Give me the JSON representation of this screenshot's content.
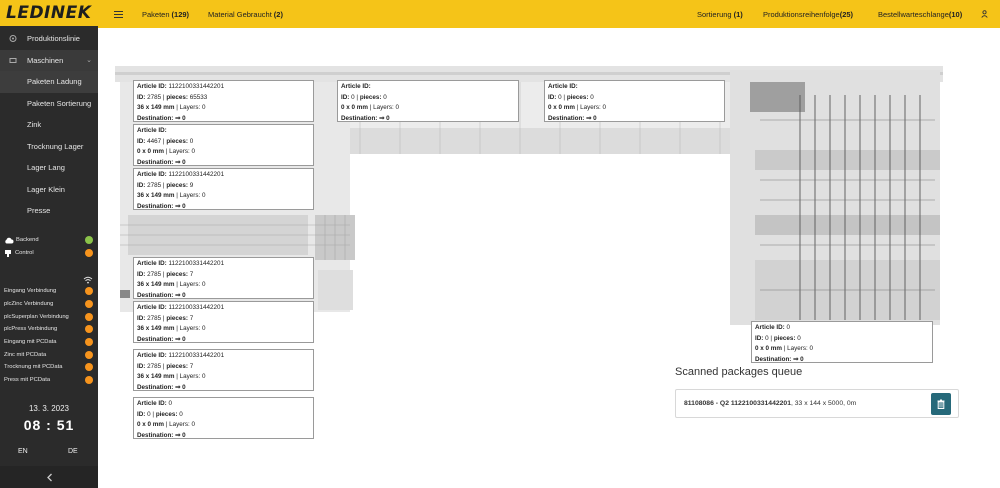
{
  "brand": {
    "logo_text": "LEDINEK"
  },
  "topbar": {
    "menu_icon": "hamburger-icon",
    "pakete_label": "Paketen",
    "pakete_count": "(129)",
    "material_label": "Material Gebraucht",
    "material_count": "(2)",
    "sortierung_label": "Sortierung",
    "sortierung_count": "(1)",
    "produktion_label": "Produktionsreihenfolge",
    "produktion_count": "(25)",
    "bestell_label": "Bestellwarteschlange",
    "bestell_count": "(10)",
    "user_icon": "user-icon"
  },
  "sidebar": {
    "items": [
      {
        "label": "Produktionslinie",
        "icon": "production-line-icon"
      },
      {
        "label": "Maschinen",
        "icon": "machine-icon"
      }
    ],
    "subitems": [
      {
        "label": "Paketen Ladung"
      },
      {
        "label": "Paketen Sortierung"
      },
      {
        "label": "Zink"
      },
      {
        "label": "Trocknung Lager"
      },
      {
        "label": "Lager Lang"
      },
      {
        "label": "Lager Klein"
      },
      {
        "label": "Presse"
      }
    ],
    "status_top": [
      {
        "label": "Backend",
        "icon": "cloud-icon",
        "state": "green"
      },
      {
        "label": "Control",
        "icon": "plug-icon",
        "state": "orange"
      }
    ],
    "connections": [
      {
        "label": "Eingang Verbindung"
      },
      {
        "label": "plcZinc Verbindung"
      },
      {
        "label": "plcSuperplan Verbindung"
      },
      {
        "label": "plcPress Verbindung"
      },
      {
        "label": "Eingang mit PCData"
      },
      {
        "label": "Zinc mit PCData"
      },
      {
        "label": "Trocknung mit PCData"
      },
      {
        "label": "Press mit PCData"
      }
    ],
    "date": "13. 3. 2023",
    "time": "08 : 51",
    "lang_en": "EN",
    "lang_de": "DE"
  },
  "colors": {
    "accent": "#f5c418",
    "sidebar": "#2b2b2b",
    "ok": "#8bc34a",
    "warn": "#f7941d",
    "trash": "#26697a"
  },
  "labels": {
    "article": "Article ID:",
    "id": "ID:",
    "pieces": "pieces:",
    "layers": "Layers:",
    "destination": "Destination:",
    "arrow": "⇒"
  },
  "boxes": [
    {
      "article": "1122100331442201",
      "id": "2785",
      "pieces": "65533",
      "dims": "36 x 149 mm",
      "layers": "0",
      "dest": "0"
    },
    {
      "article": "",
      "id": "0",
      "pieces": "0",
      "dims": "0 x 0 mm",
      "layers": "0",
      "dest": "0"
    },
    {
      "article": "",
      "id": "0",
      "pieces": "0",
      "dims": "0 x 0 mm",
      "layers": "0",
      "dest": "0"
    },
    {
      "article": "",
      "id": "4467",
      "pieces": "0",
      "dims": "0 x 0 mm",
      "layers": "0",
      "dest": "0"
    },
    {
      "article": "1122100331442201",
      "id": "2785",
      "pieces": "9",
      "dims": "36 x 149 mm",
      "layers": "0",
      "dest": "0"
    },
    {
      "article": "1122100331442201",
      "id": "2785",
      "pieces": "7",
      "dims": "36 x 149 mm",
      "layers": "0",
      "dest": "0"
    },
    {
      "article": "1122100331442201",
      "id": "2785",
      "pieces": "7",
      "dims": "36 x 149 mm",
      "layers": "0",
      "dest": "0"
    },
    {
      "article": "1122100331442201",
      "id": "2785",
      "pieces": "7",
      "dims": "36 x 149 mm",
      "layers": "0",
      "dest": "0"
    },
    {
      "article": "0",
      "id": "0",
      "pieces": "0",
      "dims": "0 x 0 mm",
      "layers": "0",
      "dest": "0"
    },
    {
      "article": "0",
      "id": "0",
      "pieces": "0",
      "dims": "0 x 0 mm",
      "layers": "0",
      "dest": "0"
    }
  ],
  "queue": {
    "title": "Scanned packages queue",
    "item_bold": "81108086 - Q2 1122100331442201",
    "item_rest": ", 33 x 144 x 5000, 0m",
    "delete_icon": "trash-icon"
  }
}
